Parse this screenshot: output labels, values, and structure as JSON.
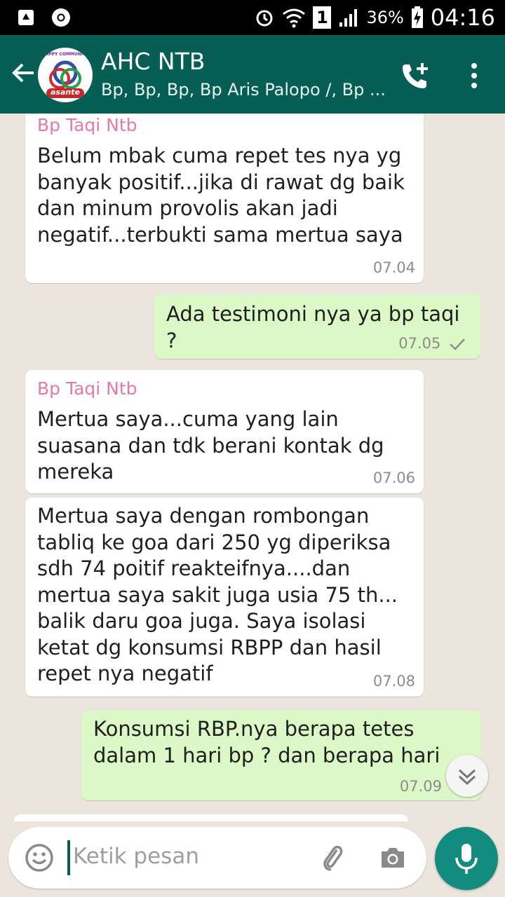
{
  "status_bar": {
    "battery": "36%",
    "time": "04:16",
    "sim_slot": "1"
  },
  "header": {
    "title": "AHC NTB",
    "subtitle": "Bp, Bp, Bp, Bp Aris Palopo /, Bp ...",
    "avatar_text_top": "HAPPY COMMUNITY",
    "avatar_text_bottom": "asante"
  },
  "messages": [
    {
      "direction": "in",
      "sender": "Bp Taqi Ntb",
      "text": "Belum mbak cuma repet tes nya yg banyak positif...jika di rawat dg baik dan minum provolis akan jadi negatif...terbukti sama mertua saya",
      "time": "07.04"
    },
    {
      "direction": "out",
      "sender": "",
      "text": "Ada testimoni nya ya bp taqi ?",
      "time": "07.05"
    },
    {
      "direction": "in",
      "sender": "Bp Taqi Ntb",
      "text": "Mertua saya...cuma yang lain suasana dan tdk berani kontak dg mereka",
      "time": "07.06"
    },
    {
      "direction": "in",
      "sender": "",
      "text": "Mertua saya dengan rombongan tabliq ke goa dari 250 yg diperiksa sdh 74 poitif reakteifnya....dan mertua saya sakit juga usia 75 th... balik daru goa juga. Saya isolasi ketat dg konsumsi RBPP dan hasil repet nya negatif",
      "time": "07.08"
    },
    {
      "direction": "out",
      "sender": "",
      "text": "Konsumsi RBP.nya berapa tetes dalam 1 hari bp ? dan berapa hari",
      "time": "07.09"
    }
  ],
  "input": {
    "placeholder": "Ketik pesan"
  },
  "colors": {
    "header": "#075e54",
    "outgoing": "#dcf8c6",
    "incoming": "#ffffff",
    "sender_name": "#e579a7",
    "mic": "#128c7e"
  },
  "icons": [
    "back-arrow-icon",
    "add-call-icon",
    "more-vert-icon",
    "emoji-icon",
    "attach-icon",
    "camera-icon",
    "mic-icon",
    "scroll-down-icon",
    "read-check-icon"
  ]
}
